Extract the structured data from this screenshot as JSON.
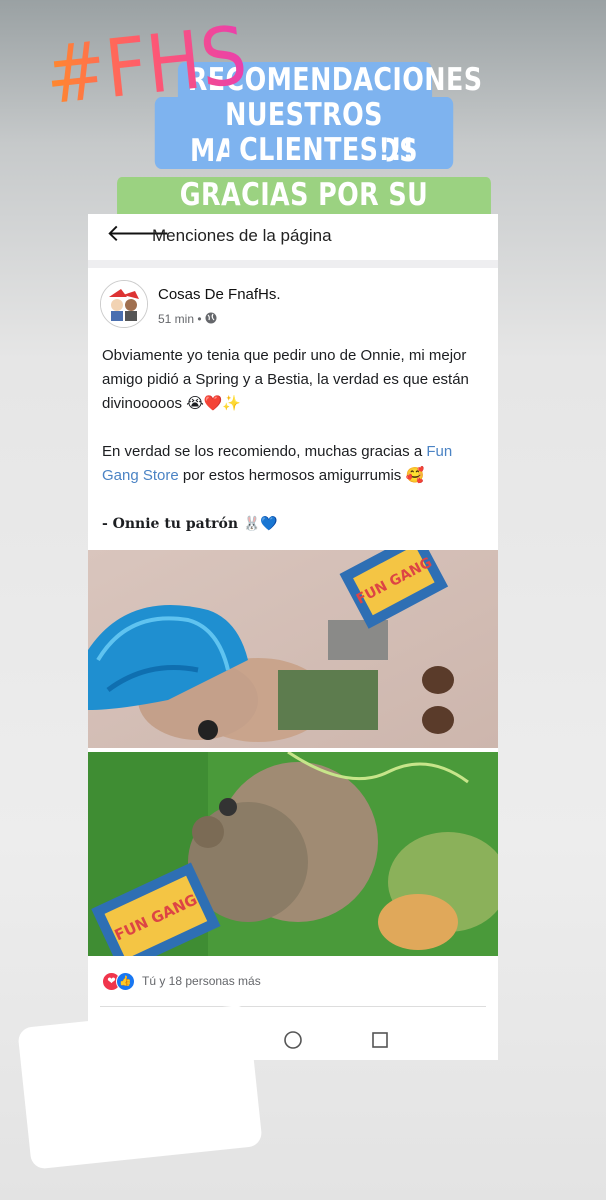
{
  "story": {
    "banner_line1": "RECOMENDACIONES DE",
    "banner_line2": "NUESTROS MARAVILLOSOS",
    "banner_line3": "CLIENTES!!!",
    "banner_line4": "GRACIAS POR SU PREFERENCIA",
    "hashtag": "#FHS",
    "colors": {
      "banner_blue": "#7eb3ef",
      "banner_green": "#9bd281",
      "hashtag_from": "#ff8a2a",
      "hashtag_to": "#e93fae"
    }
  },
  "topbar": {
    "back_icon": "back-arrow-icon",
    "title": "Menciones de la página"
  },
  "post": {
    "author": "Cosas De FnafHs.",
    "time": "51 min",
    "privacy_icon": "globe-icon",
    "paragraph1": "Obviamente yo tenia que pedir uno de Onnie, mi mejor amigo pidió a Spring y a Bestia, la verdad es que están divinooooos 😭❤️✨",
    "paragraph2_pre": "En verdad se los recomiendo, muchas gracias a ",
    "paragraph2_link": "Fun Gang Store",
    "paragraph2_post": " por estos hermosos amigurrumis 🥰",
    "signature": "- Onnie tu patrón 🐰💙"
  },
  "reactions": {
    "text": "Tú y 18 personas más",
    "icons": [
      "love-reaction-icon",
      "like-reaction-icon"
    ]
  }
}
